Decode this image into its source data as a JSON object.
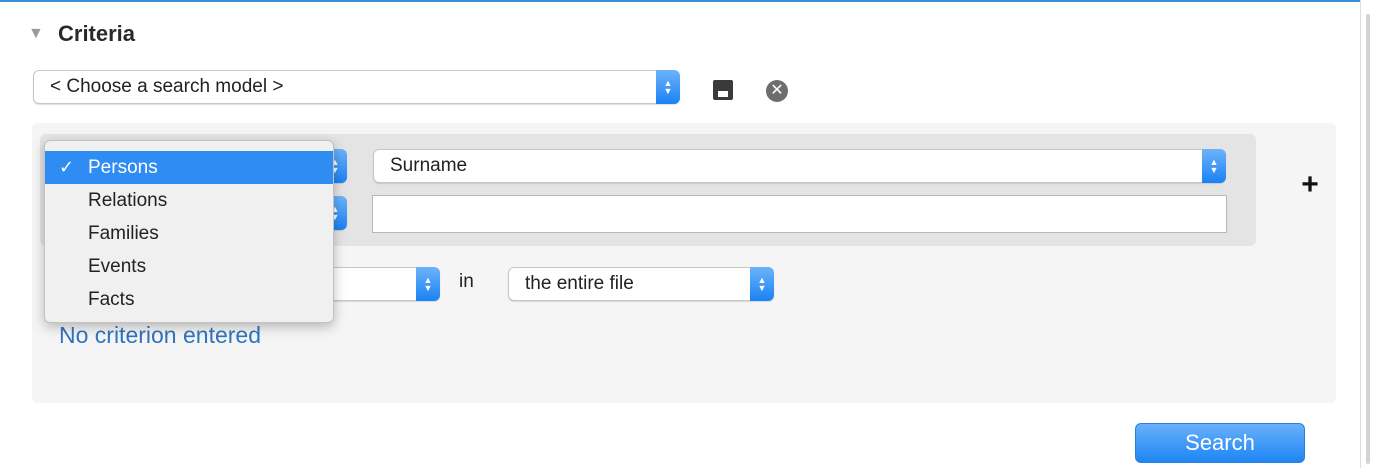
{
  "section": {
    "title": "Criteria",
    "toggle_icon": "disclosure-triangle-down"
  },
  "search_model": {
    "value": "< Choose a search model >"
  },
  "actions": {
    "save_icon": "floppy-disk",
    "clear_icon": "close-circle"
  },
  "criterion": {
    "field_value": "Surname",
    "text_value": "",
    "add_icon": "plus"
  },
  "scope": {
    "in_label": "in",
    "value": "the entire file"
  },
  "type_menu": {
    "items": [
      {
        "label": "Persons",
        "checked": true
      },
      {
        "label": "Relations"
      },
      {
        "label": "Families"
      },
      {
        "label": "Events"
      },
      {
        "label": "Facts"
      }
    ]
  },
  "status": {
    "text": "No criterion entered"
  },
  "buttons": {
    "search": "Search"
  },
  "colors": {
    "accent": "#2f8cf3",
    "link": "#2f74c0",
    "top_border": "#3b8fd6"
  }
}
